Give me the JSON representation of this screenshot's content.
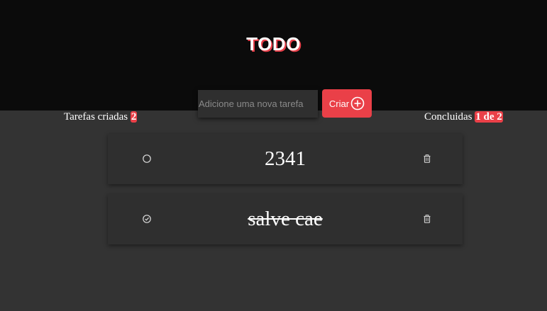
{
  "app": {
    "title": "TODO"
  },
  "form": {
    "input_placeholder": "Adicione uma nova tarefa",
    "input_value": "",
    "create_label": "Criar"
  },
  "counters": {
    "created_label": "Tarefas criadas",
    "created_count": "2",
    "completed_label": "Concluidas",
    "completed_count": "1 de 2"
  },
  "tasks": [
    {
      "text": "2341",
      "done": false
    },
    {
      "text": "salve cae",
      "done": true
    }
  ],
  "colors": {
    "accent": "#ea4048",
    "header_bg": "#0b0b0b",
    "page_bg": "#333333",
    "card_bg": "#2f2f2f"
  },
  "icons": {
    "create": "plus-circle-icon",
    "unchecked": "circle-icon",
    "checked": "check-circle-icon",
    "delete": "trash-icon"
  }
}
